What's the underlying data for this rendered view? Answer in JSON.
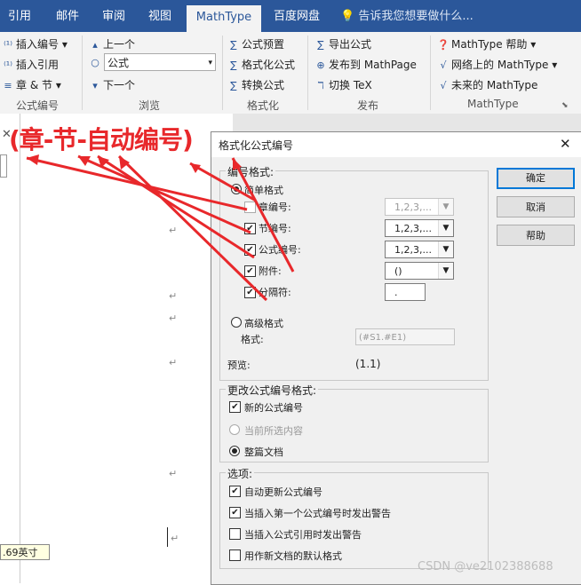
{
  "ribbon_tabs": [
    "引用",
    "邮件",
    "审阅",
    "视图",
    "MathType",
    "百度网盘"
  ],
  "tell_me": "告诉我您想要做什么...",
  "ribbon": {
    "group1": {
      "items": [
        "插入编号",
        "插入引用",
        "章 & 节"
      ],
      "label": "公式编号"
    },
    "group2": {
      "items": [
        "上一个",
        "下一个"
      ],
      "combo_value": "公式",
      "label": "浏览"
    },
    "group3": {
      "items": [
        "公式预置",
        "格式化公式",
        "转换公式"
      ],
      "label": "格式化"
    },
    "group4": {
      "items": [
        "导出公式",
        "发布到 MathPage",
        "切换 TeX"
      ],
      "label": "发布"
    },
    "group5": {
      "items": [
        "MathType 帮助",
        "网络上的 MathType",
        "未来的 MathType"
      ],
      "label": "MathType"
    }
  },
  "annotation": "(章-节-自动编号)",
  "ruler_tip": ".69英寸",
  "dialog": {
    "title": "格式化公式编号",
    "numbering_format": {
      "legend": "编号格式:",
      "simple": "简单格式",
      "rows": [
        {
          "label": "章编号:",
          "value": "1,2,3,...",
          "checked": false,
          "disabled": true
        },
        {
          "label": "节编号:",
          "value": "1,2,3,...",
          "checked": true,
          "disabled": false
        },
        {
          "label": "公式编号:",
          "value": "1,2,3,...",
          "checked": true,
          "disabled": false
        },
        {
          "label": "附件:",
          "value": "()",
          "checked": true,
          "disabled": false
        },
        {
          "label": "分隔符:",
          "value": ".",
          "checked": true,
          "disabled": false
        }
      ],
      "advanced": "高级格式",
      "format_label": "格式:",
      "format_value": "(#S1.#E1)",
      "preview_label": "预览:",
      "preview_value": "(1.1)"
    },
    "change_format": {
      "legend": "更改公式编号格式:",
      "new_numbers": "新的公式编号",
      "current_selection": "当前所选内容",
      "whole_document": "整篇文档"
    },
    "options": {
      "legend": "选项:",
      "items": [
        "自动更新公式编号",
        "当插入第一个公式编号时发出警告",
        "当插入公式引用时发出警告",
        "用作新文档的默认格式"
      ],
      "checked": [
        true,
        true,
        false,
        false
      ]
    },
    "buttons": {
      "ok": "确定",
      "cancel": "取消",
      "help": "帮助"
    }
  },
  "watermark": "CSDN @ve2102388688"
}
